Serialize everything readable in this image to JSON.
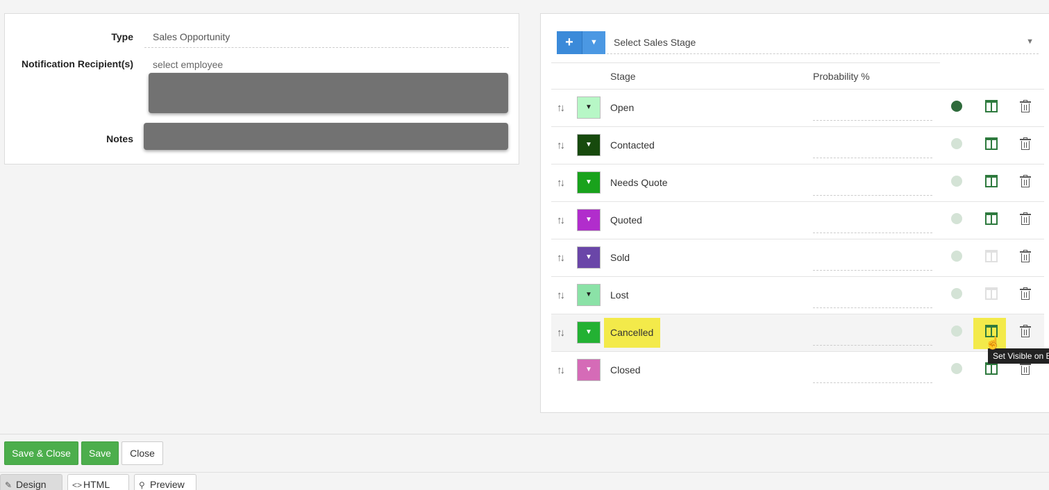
{
  "form": {
    "type_label": "Type",
    "type_value": "Sales Opportunity",
    "recipients_label": "Notification Recipient(s)",
    "recipients_placeholder": "select employee",
    "notes_label": "Notes"
  },
  "stages": {
    "add_icon": "plus-icon",
    "select_placeholder": "Select Sales Stage",
    "col_stage": "Stage",
    "col_probability": "Probability %",
    "rows": [
      {
        "name": "Open",
        "color": "#b7f7c6",
        "caret_dark": true,
        "dot_on": true,
        "visible": true
      },
      {
        "name": "Contacted",
        "color": "#174a0d",
        "caret_dark": false,
        "dot_on": false,
        "visible": true
      },
      {
        "name": "Needs Quote",
        "color": "#19a21c",
        "caret_dark": false,
        "dot_on": false,
        "visible": true
      },
      {
        "name": "Quoted",
        "color": "#b12dcc",
        "caret_dark": false,
        "dot_on": false,
        "visible": true
      },
      {
        "name": "Sold",
        "color": "#6a46a8",
        "caret_dark": false,
        "dot_on": false,
        "visible": false
      },
      {
        "name": "Lost",
        "color": "#8be2a7",
        "caret_dark": true,
        "dot_on": false,
        "visible": false
      },
      {
        "name": "Cancelled",
        "color": "#23b133",
        "caret_dark": false,
        "dot_on": false,
        "visible": true,
        "highlighted": true
      },
      {
        "name": "Closed",
        "color": "#d56bb7",
        "caret_dark": false,
        "dot_on": false,
        "visible": true
      }
    ],
    "tooltip": "Set Visible on B"
  },
  "footer": {
    "save_close": "Save & Close",
    "save": "Save",
    "close": "Close"
  },
  "tabs": {
    "design": "Design",
    "html": "HTML",
    "preview": "Preview"
  }
}
